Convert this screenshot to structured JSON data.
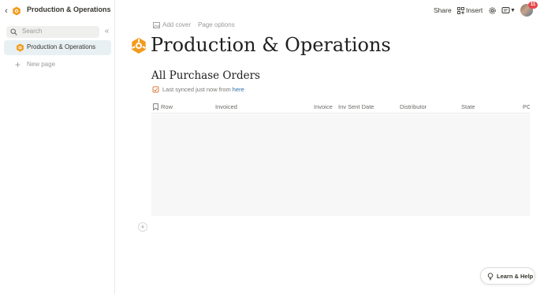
{
  "sidebar": {
    "workspace_title": "Production & Operations",
    "search_placeholder": "Search",
    "items": [
      {
        "label": "Production & Operations",
        "active": true
      }
    ],
    "new_page_label": "New page"
  },
  "topbar": {
    "share_label": "Share",
    "insert_label": "Insert",
    "notification_count": "11"
  },
  "page": {
    "add_cover_label": "Add cover",
    "page_options_label": "Page options",
    "title": "Production & Operations"
  },
  "section": {
    "title": "All Purchase Orders",
    "sync_text": "Last synced just now from ",
    "sync_link": "here"
  },
  "table": {
    "columns": [
      "Row",
      "Invoiced",
      "Invoice",
      "Inv Sent Date",
      "Distributor",
      "State",
      "PO"
    ]
  },
  "help": {
    "label": "Learn & Help"
  },
  "colors": {
    "accent_orange": "#f29b1d",
    "active_item_bg": "#e8f0f4",
    "badge_red": "#e5484d",
    "link_blue": "#2f6fab"
  }
}
